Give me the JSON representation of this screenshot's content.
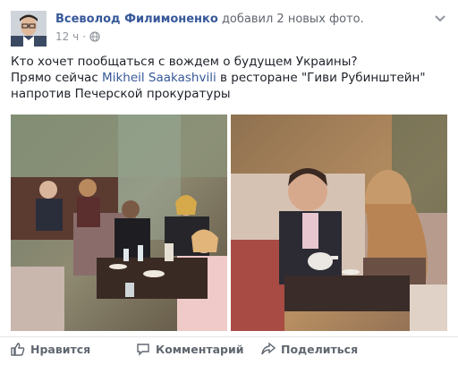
{
  "post": {
    "author": "Всеволод Филимоненко",
    "action": "добавил 2 новых фото.",
    "time": "12 ч",
    "separator": "·",
    "text_line1": "Кто хочет пообщаться с вождем о будущем Украины?",
    "text_line2_prefix": "Прямо сейчас ",
    "text_line2_link": "Mikheil Saakashvili",
    "text_line2_suffix": " в ресторане \"Гиви Рубинштейн\"",
    "text_line3": "напротив Печерской прокуратуры"
  },
  "actions": {
    "like": "Нравится",
    "comment": "Комментарий",
    "share": "Поделиться"
  },
  "icons": {
    "avatar": "avatar-icon",
    "globe": "globe-icon",
    "chevron": "chevron-down-icon",
    "like": "thumbs-up-icon",
    "comment": "comment-icon",
    "share": "share-icon"
  },
  "colors": {
    "link": "#365899",
    "muted": "#90949c",
    "text": "#1d2129"
  }
}
